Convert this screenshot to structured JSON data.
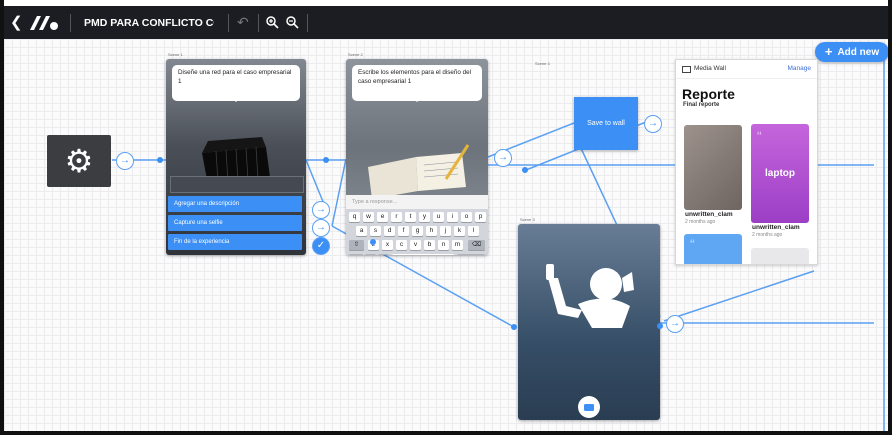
{
  "topbar": {
    "back_icon": "chevron-left-icon",
    "logo_icon": "app-logo-icon",
    "title": "PMD PARA CONFLICTO CO",
    "undo_icon": "undo-icon",
    "zoom_in_icon": "zoom-in-icon",
    "zoom_out_icon": "zoom-out-icon"
  },
  "add_new": {
    "label": "Add new",
    "icon": "plus-icon"
  },
  "start_node": {
    "icon": "gear-icon"
  },
  "scene1": {
    "label": "Scene 1",
    "prompt": "Diseñe una red para el caso empresarial 1",
    "options": [
      "Agregar una descripción",
      "Capture una selfie",
      "Fin de la experiencia"
    ]
  },
  "scene2": {
    "label": "Scene 2",
    "prompt": "Escribe los elementos para el diseño del caso empresarial 1",
    "input_placeholder": "Type a response...",
    "keyboard": {
      "row1": [
        "q",
        "w",
        "e",
        "r",
        "t",
        "y",
        "u",
        "i",
        "o",
        "p"
      ],
      "row2": [
        "a",
        "s",
        "d",
        "f",
        "g",
        "h",
        "j",
        "k",
        "l"
      ],
      "row3": [
        "z",
        "x",
        "c",
        "v",
        "b",
        "n",
        "m"
      ],
      "numbers_key": "123",
      "space_key": "space",
      "return_key": "return"
    }
  },
  "scene3": {
    "label": "Scene 3"
  },
  "scene4": {
    "label": "Scene 4"
  },
  "save_node": {
    "label": "Save to wall"
  },
  "media_wall": {
    "header": "Media Wall",
    "manage": "Manage",
    "title": "Reporte",
    "subtitle": "Final reporte",
    "items": [
      {
        "name": "unwritten_clam",
        "time": "2 months ago"
      },
      {
        "name": "unwritten_clam",
        "time": "2 months ago",
        "text": "laptop"
      }
    ]
  },
  "colors": {
    "accent": "#3b8ff5",
    "topbar": "#1c1d22",
    "tile_purple": "#b04fd6"
  }
}
